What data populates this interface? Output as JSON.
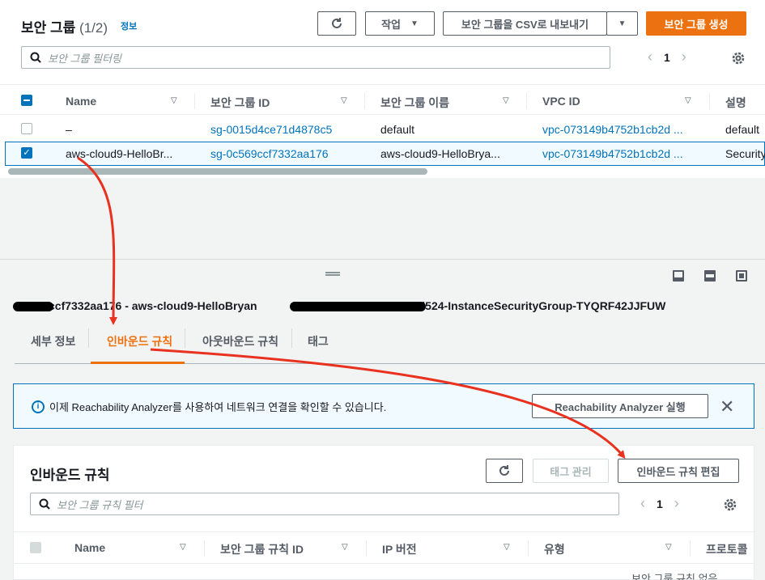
{
  "security_groups": {
    "title": "보안 그룹",
    "count": "(1/2)",
    "info_link": "정보",
    "actions_label": "작업",
    "export_label": "보안 그룹을 CSV로 내보내기",
    "create_label": "보안 그룹 생성",
    "filter_placeholder": "보안 그룹 필터링",
    "page": "1",
    "columns": [
      "Name",
      "보안 그룹 ID",
      "보안 그룹 이름",
      "VPC ID",
      "설명"
    ],
    "rows": [
      {
        "name": "–",
        "group_id": "sg-0015d4ce71d4878c5",
        "group_name": "default",
        "vpc_id": "vpc-073149b4752b1cb2d ...",
        "description": "default",
        "selected": false
      },
      {
        "name": "aws-cloud9-HelloBr...",
        "group_id": "sg-0c569ccf7332aa176",
        "group_name": "aws-cloud9-HelloBrya...",
        "vpc_id": "vpc-073149b4752b1cb2d ...",
        "description": "Security",
        "selected": true
      }
    ]
  },
  "detail": {
    "title_visible_part1": "ccf7332aa176 - aws-cloud9-HelloBryan",
    "title_visible_part2": "203748b2d524-InstanceSecurityGroup-TYQRF42JJFUW",
    "tabs": [
      "세부 정보",
      "인바운드 규칙",
      "아웃바운드 규칙",
      "태그"
    ],
    "active_tab": "인바운드 규칙"
  },
  "banner": {
    "message": "이제 Reachability Analyzer를 사용하여 네트워크 연결을 확인할 수 있습니다.",
    "action_label": "Reachability Analyzer 실행"
  },
  "inbound_rules": {
    "title": "인바운드 규칙",
    "manage_tags_label": "태그 관리",
    "edit_label": "인바운드 규칙 편집",
    "filter_placeholder": "보안 그룹 규칙 필터",
    "page": "1",
    "columns": [
      "Name",
      "보안 그룹 규칙 ID",
      "IP 버전",
      "유형",
      "프로토콜"
    ],
    "empty_text": "보안 그룹 규칙 없음"
  },
  "colors": {
    "accent": "#ec7211",
    "link": "#0073bb",
    "annotation_arrow": "#e8321f"
  }
}
